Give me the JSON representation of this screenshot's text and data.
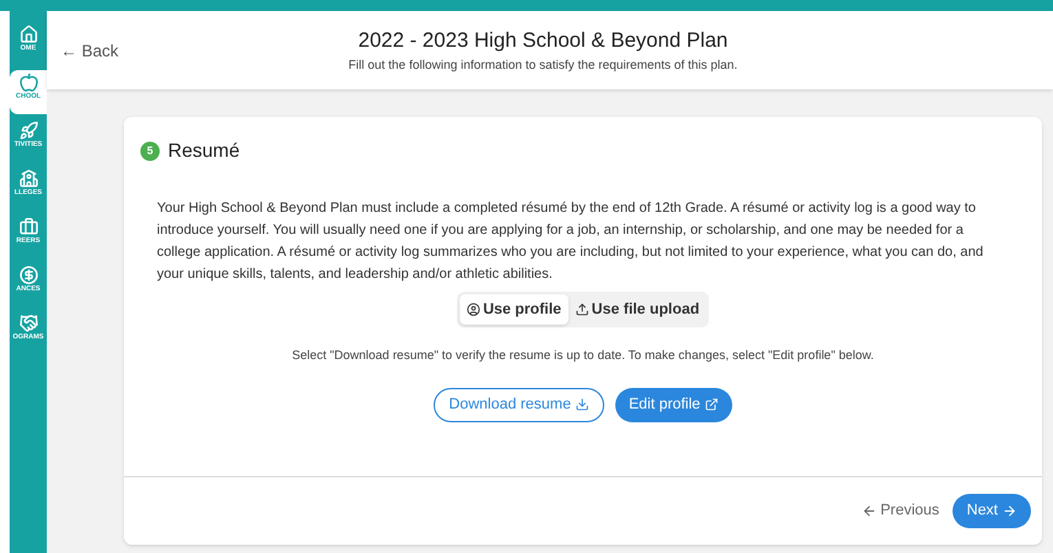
{
  "sidebar": {
    "items": [
      {
        "label": "OME",
        "kind": "home",
        "selected": false
      },
      {
        "label": "CHOOL",
        "kind": "apple",
        "selected": true
      },
      {
        "label": "TIVITIES",
        "kind": "activity",
        "selected": false
      },
      {
        "label": "LLEGES",
        "kind": "college",
        "selected": false
      },
      {
        "label": "REERS",
        "kind": "briefcase",
        "selected": false
      },
      {
        "label": "ANCES",
        "kind": "moneybag",
        "selected": false
      },
      {
        "label": "OGRAMS",
        "kind": "handshake",
        "selected": false
      }
    ]
  },
  "header": {
    "back": "← Back",
    "title": "2022 - 2023 High School & Beyond Plan",
    "subtitle": "Fill out the following information to satisfy the requirements of this plan."
  },
  "step": {
    "number": "5",
    "title": "Resumé"
  },
  "intro": "Your High School & Beyond Plan must include a completed résumé by the end of 12th Grade. A résumé or activity log is a good way to introduce yourself. You will usually need one if you are applying for a job, an internship, or scholarship, and one may be needed for a college application. A résumé or activity log summarizes who you are including, but not limited to your experience, what you can do, and your unique skills, talents, and leadership and/or athletic abilities.",
  "source_toggle": [
    {
      "label": "Use profile",
      "kind": "profile",
      "selected": true
    },
    {
      "label": "Use file upload",
      "kind": "upload",
      "selected": false
    }
  ],
  "instructions": "Select \"Download resume\" to verify the resume is up to date. To make changes, select \"Edit profile\" below.",
  "actions": [
    {
      "label": "Download resume",
      "kind": "outline"
    },
    {
      "label": "Edit profile",
      "kind": "solid"
    }
  ],
  "footer": {
    "previous": "Previous",
    "next": "Next"
  }
}
